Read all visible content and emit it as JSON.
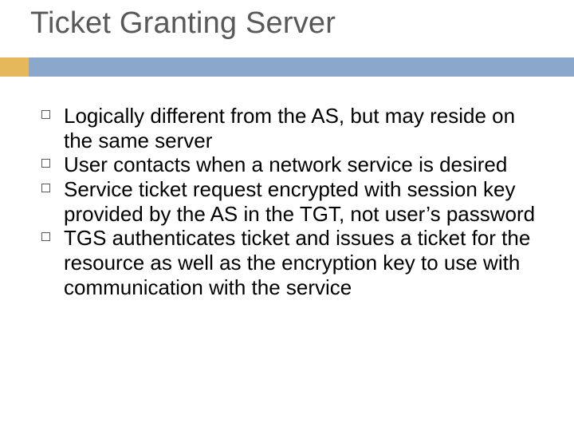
{
  "title": "Ticket Granting Server",
  "bullets": [
    "Logically different from the AS, but may reside on the same server",
    "User contacts when a network service is desired",
    "Service ticket request encrypted with session key provided by the AS in the TGT, not user’s password",
    "TGS authenticates ticket and issues a ticket for the resource as well as the encryption key to use with communication with the service"
  ],
  "colors": {
    "bar": "#8CA7CC",
    "accent": "#E6B85C",
    "title_text": "#595959",
    "bar_style": "background:#8CA7CC",
    "accent_style": "background:#E6B85C"
  }
}
